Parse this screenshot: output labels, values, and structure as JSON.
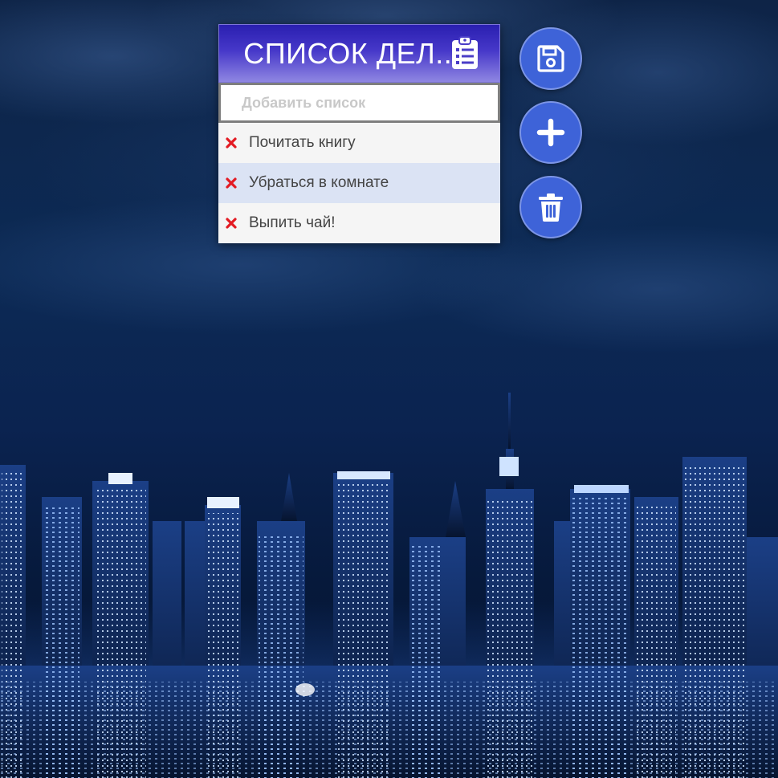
{
  "app": {
    "title": "СПИСОК ДЕЛ...",
    "title_icon": "clipboard-list-icon"
  },
  "input": {
    "placeholder": "Добавить список",
    "value": ""
  },
  "todos": [
    {
      "label": "Почитать книгу",
      "delete_icon": "close-icon"
    },
    {
      "label": "Убраться в комнате",
      "delete_icon": "close-icon"
    },
    {
      "label": "Выпить чай!",
      "delete_icon": "close-icon"
    }
  ],
  "actions": [
    {
      "name": "save",
      "icon": "floppy-disk-icon"
    },
    {
      "name": "add",
      "icon": "plus-icon"
    },
    {
      "name": "clear",
      "icon": "trash-icon"
    }
  ],
  "colors": {
    "header_gradient_top": "#2a1fb0",
    "header_gradient_bottom": "#8f86e2",
    "fab": "#3e63d8",
    "delete_x": "#e31b23",
    "row_alt": "#dbe3f4",
    "row": "#f5f5f5"
  }
}
